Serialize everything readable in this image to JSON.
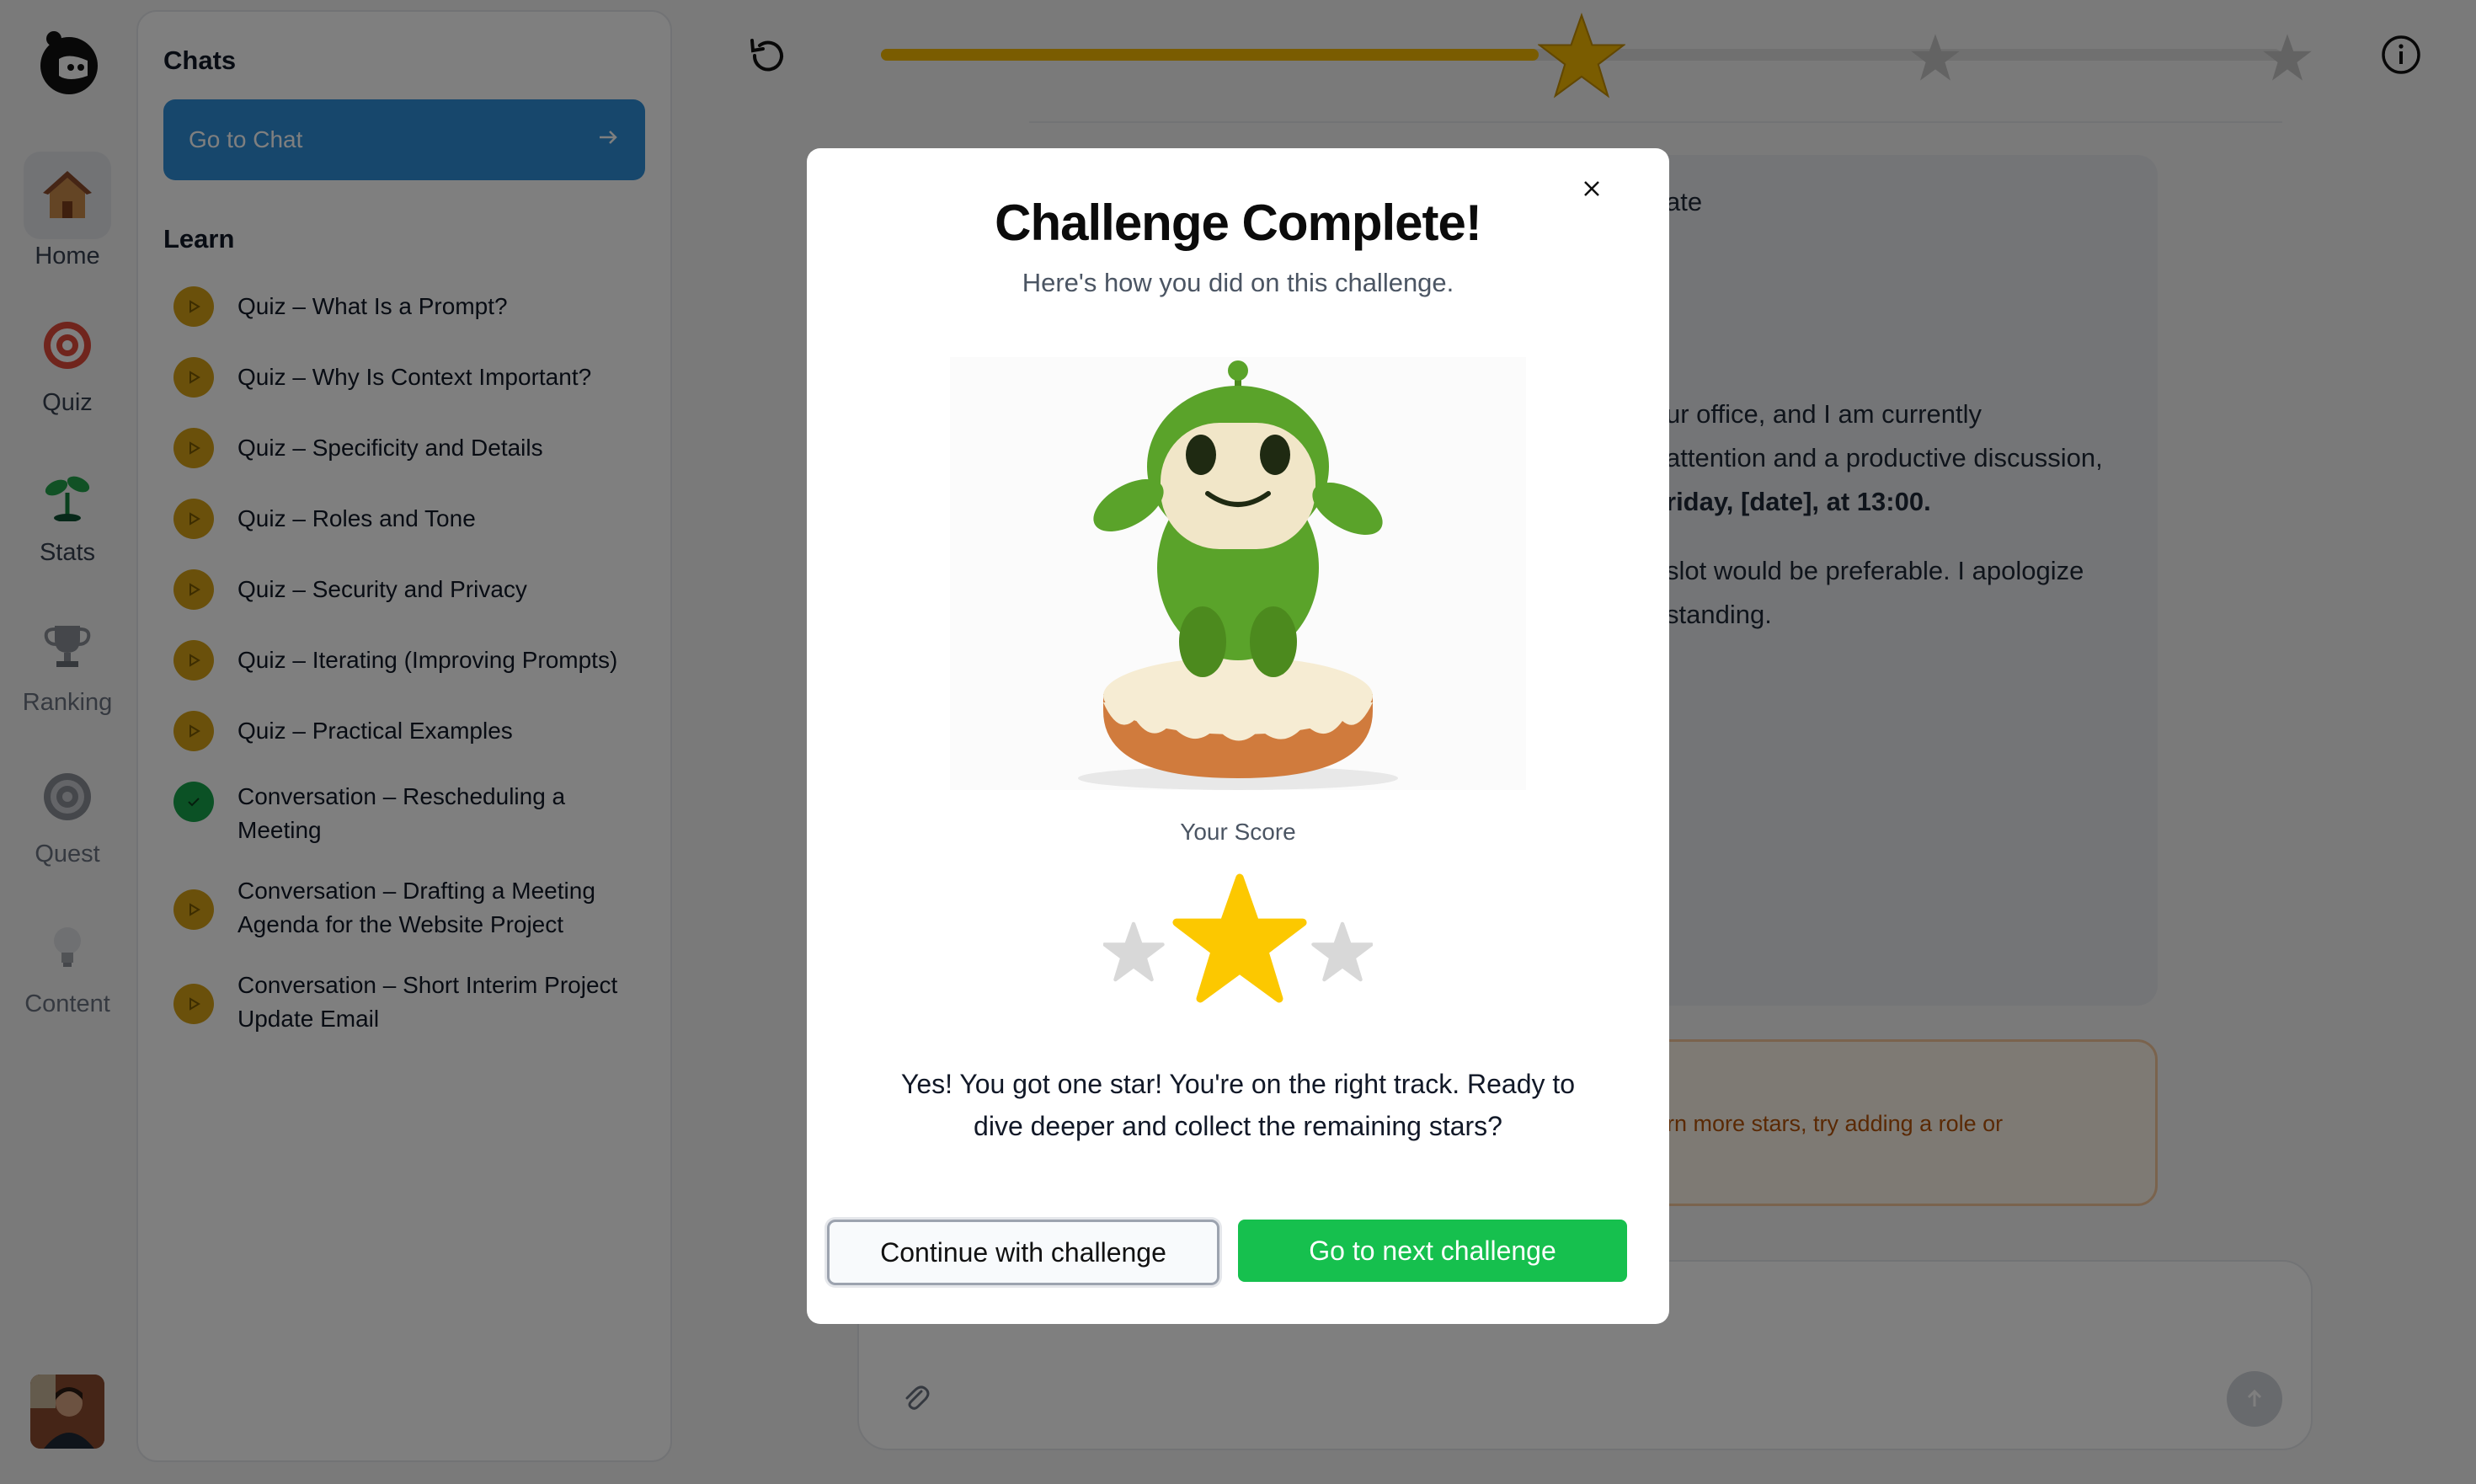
{
  "nav": {
    "items": [
      {
        "label": "Home",
        "icon": "house-icon"
      },
      {
        "label": "Quiz",
        "icon": "target-icon"
      },
      {
        "label": "Stats",
        "icon": "sprout-icon"
      },
      {
        "label": "Ranking",
        "icon": "trophy-icon"
      },
      {
        "label": "Quest",
        "icon": "bullseye-icon"
      },
      {
        "label": "Content",
        "icon": "lightbulb-icon"
      }
    ]
  },
  "sidebar": {
    "chats_heading": "Chats",
    "goto_chat_label": "Go to Chat",
    "learn_heading": "Learn",
    "lessons": [
      {
        "label": "Quiz – What Is a Prompt?",
        "status": "play"
      },
      {
        "label": "Quiz – Why Is Context Important?",
        "status": "play"
      },
      {
        "label": "Quiz – Specificity and Details",
        "status": "play"
      },
      {
        "label": "Quiz – Roles and Tone",
        "status": "play"
      },
      {
        "label": "Quiz – Security and Privacy",
        "status": "play"
      },
      {
        "label": "Quiz – Iterating (Improving Prompts)",
        "status": "play"
      },
      {
        "label": "Quiz – Practical Examples",
        "status": "play"
      },
      {
        "label": "Conversation – Rescheduling a Meeting",
        "status": "done"
      },
      {
        "label": "Conversation – Drafting a Meeting Agenda for the Website Project",
        "status": "play"
      },
      {
        "label": "Conversation – Short Interim Project Update Email",
        "status": "play"
      }
    ]
  },
  "progress": {
    "fraction": 0.47,
    "stars_total": 3,
    "stars_earned": 1
  },
  "background_message": {
    "line1": "ate",
    "line2": "ur office, and I am currently",
    "line3": "attention and a productive discussion,",
    "line4": "riday, [date], at 13:00.",
    "line5": "slot would be preferable. I apologize",
    "line6": "standing."
  },
  "tip": {
    "text": "rn more stars, try adding a role or"
  },
  "modal": {
    "title": "Challenge Complete!",
    "subtitle": "Here's how you did on this challenge.",
    "score_label": "Your Score",
    "score_stars": 1,
    "score_max": 3,
    "message": "Yes! You got one star! You're on the right track. Ready to dive deeper and collect the remaining stars?",
    "continue_label": "Continue with challenge",
    "next_label": "Go to next challenge"
  },
  "colors": {
    "accent_blue": "#2f8fd8",
    "star_gold": "#f5b800",
    "success_green": "#16c04e",
    "lesson_play": "#d4a017"
  }
}
